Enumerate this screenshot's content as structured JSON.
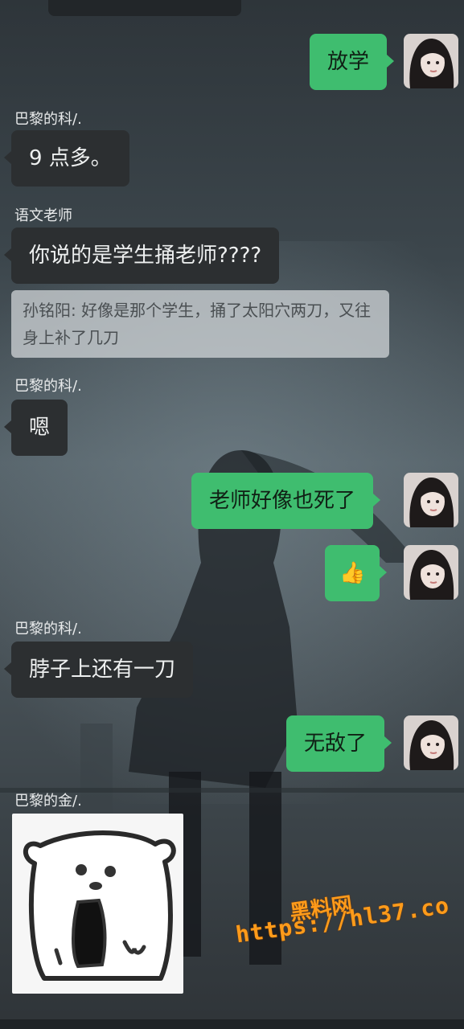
{
  "messages": {
    "m1": {
      "text": "放学"
    },
    "m2": {
      "sender": "巴黎的科/.",
      "text": "9 点多。"
    },
    "m3": {
      "sender": "语文老师",
      "text": "你说的是学生捅老师????",
      "quote": "孙铭阳: 好像是那个学生，捅了太阳穴两刀，又往身上补了几刀"
    },
    "m4": {
      "sender": "巴黎的科/.",
      "text": "嗯"
    },
    "m5": {
      "text": "老师好像也死了"
    },
    "m6": {
      "emoji": "👍"
    },
    "m7": {
      "sender": "巴黎的科/.",
      "text": "脖子上还有一刀"
    },
    "m8": {
      "text": "无敌了"
    },
    "m9": {
      "sender": "巴黎的金/."
    }
  },
  "watermark": {
    "site_name": "黑料网",
    "url": "https://hl37.co"
  },
  "icons": {
    "avatar": "avatar-girl-photo",
    "sticker": "bear-sticker-icon",
    "reaction": "thumbs-up-icon"
  },
  "colors": {
    "sent_bubble": "#3fbd6f",
    "received_bubble": "#2c2f31",
    "watermark": "#ff9b1a"
  }
}
